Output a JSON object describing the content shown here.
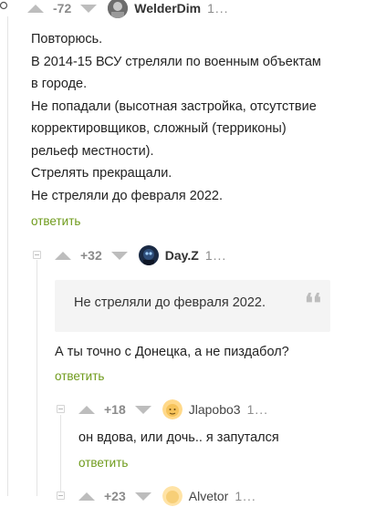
{
  "comments": [
    {
      "rating": "-72",
      "username": "WelderDim",
      "time": "1...",
      "lines": [
        "Повторюсь.",
        "В 2014-15 ВСУ стреляли по военным объектам",
        "в городе.",
        "Не попадали (высотная застройка, отсутствие",
        "корректировщиков, сложный (терриконы)",
        "рельеф местности).",
        "Стрелять прекращали.",
        "Не стреляли до февраля 2022."
      ],
      "reply_label": "ответить"
    },
    {
      "rating": "+32",
      "username": "Day.Z",
      "time": "1...",
      "quote": "Не стреляли до февраля 2022.",
      "quote_mark": "❛❛",
      "text": "А ты точно с Донецка, а не пиздабол?",
      "reply_label": "ответить"
    },
    {
      "rating": "+18",
      "username": "Jlapobo3",
      "time": "1...",
      "text": "он вдова, или дочь.. я запутался",
      "reply_label": "ответить"
    },
    {
      "rating": "+23",
      "username": "Alvetor",
      "time": "1..."
    }
  ],
  "colors": {
    "reply_link": "#6f9b1c",
    "rating": "#8b8b8b",
    "arrow": "#bdbdbd",
    "thread_line": "#e4e4e4",
    "quote_bg": "#f4f4f4"
  },
  "icons": {
    "upvote": "arrow-up-icon",
    "downvote": "arrow-down-icon",
    "collapse": "collapse-thread-icon",
    "quote": "quote-icon"
  }
}
